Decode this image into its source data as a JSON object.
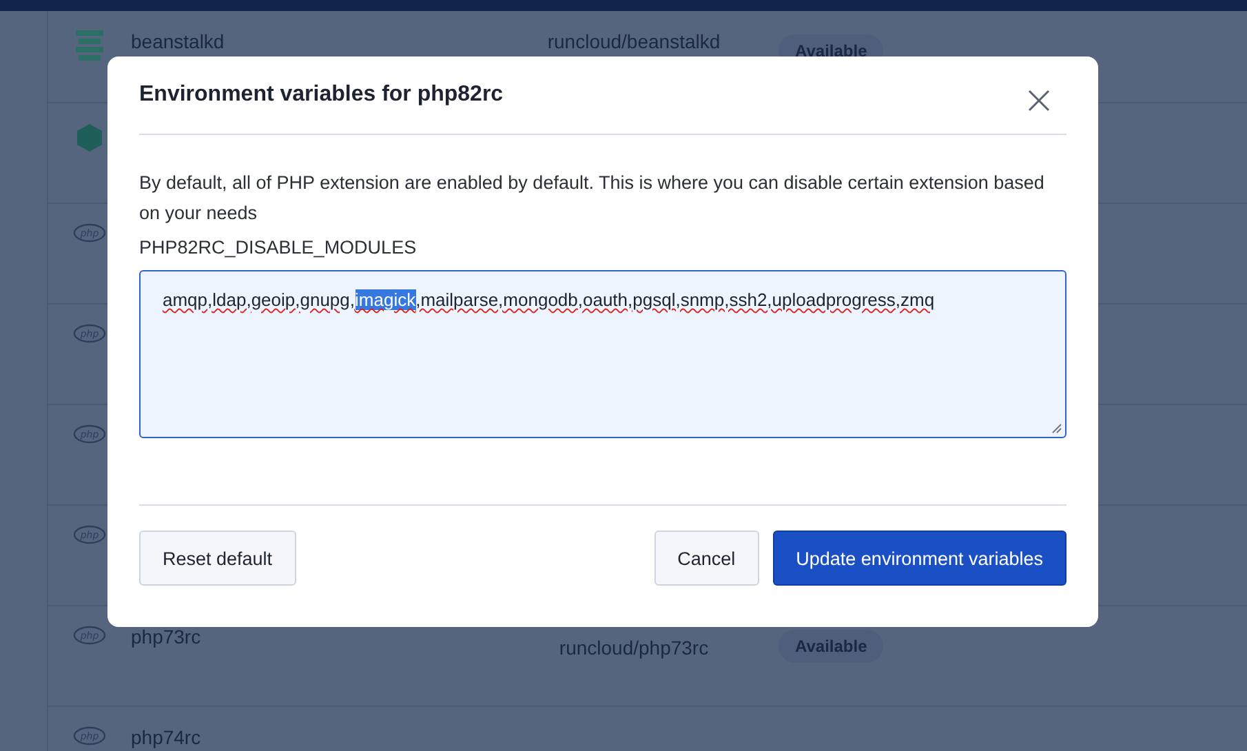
{
  "background_table": {
    "rows": [
      {
        "kind": "stack",
        "name": "beanstalkd",
        "image": "runcloud/beanstalkd",
        "status": "Available"
      },
      {
        "kind": "cube"
      },
      {
        "kind": "php"
      },
      {
        "kind": "php"
      },
      {
        "kind": "php"
      },
      {
        "kind": "php"
      },
      {
        "kind": "php",
        "name": "php73rc",
        "image": "runcloud/php73rc",
        "status": "Available"
      },
      {
        "kind": "php",
        "name": "php74rc"
      }
    ]
  },
  "modal": {
    "title": "Environment variables for php82rc",
    "description": "By default, all of PHP extension are enabled by default. This is where you can disable certain extension based on your needs",
    "field_label": "PHP82RC_DISABLE_MODULES",
    "value_parts": [
      {
        "text": "amqp,ldap,geoip,gnupg,",
        "selected": false
      },
      {
        "text": "imagick",
        "selected": true
      },
      {
        "text": ",mailparse,mongodb,oauth,pgsql,snmp,ssh2,uploadprogress,zmq",
        "selected": false
      }
    ],
    "buttons": [
      {
        "label": "Reset default",
        "kind": "secondary"
      },
      {
        "label": "Cancel",
        "kind": "secondary"
      },
      {
        "label": "Update environment variables",
        "kind": "primary"
      }
    ]
  }
}
